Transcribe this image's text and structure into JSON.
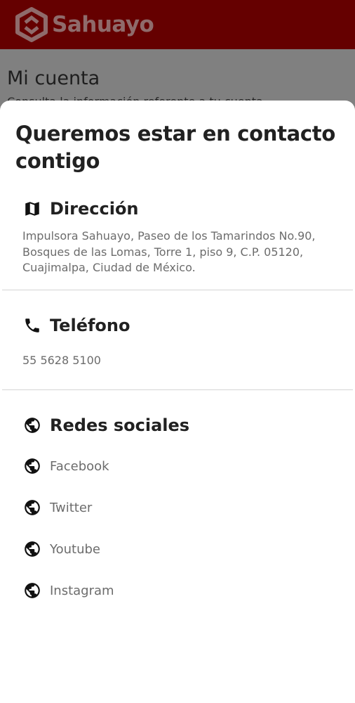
{
  "appbar": {
    "brand": "Sahuayo"
  },
  "background_page": {
    "title": "Mi cuenta",
    "subtitle": "Consulta la información referente a tu cuenta"
  },
  "sheet": {
    "title": "Queremos estar en contacto contigo",
    "address": {
      "heading": "Dirección",
      "icon": "map-icon",
      "text": "Impulsora Sahuayo, Paseo de los Tamarindos No.90, Bosques de las Lomas, Torre 1, piso 9, C.P. 05120, Cuajimalpa, Ciudad de México."
    },
    "phone": {
      "heading": "Teléfono",
      "icon": "phone-icon",
      "number": "55 5628 5100"
    },
    "social": {
      "heading": "Redes sociales",
      "icon": "globe-icon",
      "items": [
        {
          "label": "Facebook",
          "icon": "globe-icon"
        },
        {
          "label": "Twitter",
          "icon": "globe-icon"
        },
        {
          "label": "Youtube",
          "icon": "globe-icon"
        },
        {
          "label": "Instagram",
          "icon": "globe-icon"
        }
      ]
    }
  },
  "colors": {
    "appbar": "#650000",
    "brand_text": "#8f6b6b",
    "scrim": "#808080",
    "sheet": "#ffffff",
    "primary_text": "#212121",
    "secondary_text": "#6c6c6c"
  }
}
